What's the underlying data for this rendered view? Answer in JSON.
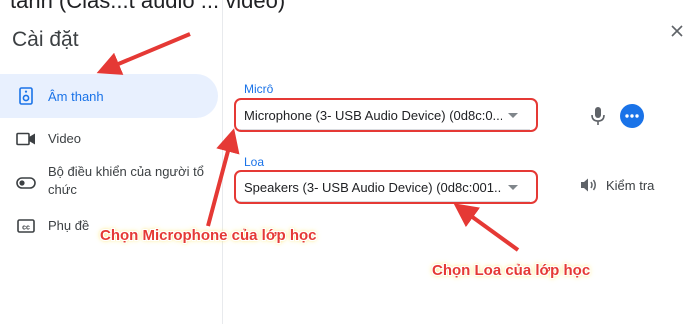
{
  "window": {
    "top_cut_text": "tanh (Clas...t audio ... video)",
    "title": "Cài đặt"
  },
  "sidebar": {
    "items": [
      {
        "label": "Âm thanh",
        "icon": "speaker-icon",
        "active": true
      },
      {
        "label": "Video",
        "icon": "video-camera-icon",
        "active": false
      },
      {
        "label": "Bộ điều khiển của người tổ chức",
        "icon": "toggle-icon",
        "active": false
      },
      {
        "label": "Phụ đề",
        "icon": "captions-icon",
        "active": false
      }
    ]
  },
  "audio": {
    "microphone": {
      "label": "Micrô",
      "value": "Microphone (3- USB Audio Device) (0d8c:0..."
    },
    "speaker": {
      "label": "Loa",
      "value": "Speakers (3- USB Audio Device) (0d8c:001..."
    },
    "test_label": "Kiểm tra"
  },
  "annotations": {
    "microphone_note": "Chọn Microphone của lớp học",
    "speaker_note": "Chọn Loa của lớp học"
  },
  "colors": {
    "accent": "#1a73e8",
    "annotation": "#e53935",
    "active_bg": "#e8f0fe"
  }
}
